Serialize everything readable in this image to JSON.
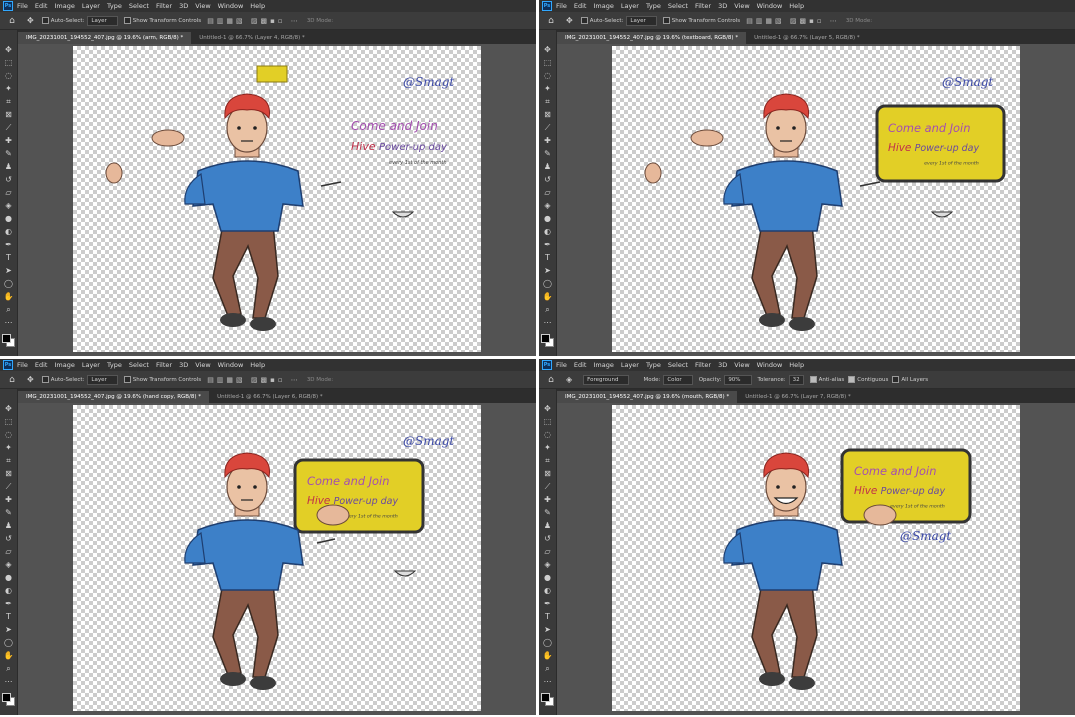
{
  "menu": [
    "File",
    "Edit",
    "Image",
    "Layer",
    "Type",
    "Select",
    "Filter",
    "3D",
    "View",
    "Window",
    "Help"
  ],
  "app_badge": "Ps",
  "colors": {
    "panel": "#535353",
    "menubar": "#323232",
    "shirt": "#3d80c8",
    "pants": "#8a5a48",
    "hair": "#d9463c",
    "board": "#e2cf26"
  },
  "move_options": {
    "auto_select": "Auto-Select:",
    "layer_dd": "Layer",
    "transform": "Show Transform Controls",
    "mode_3d": "3D Mode:"
  },
  "bucket_options": {
    "fill_dd": "Foreground",
    "mode_label": "Mode:",
    "mode_value": "Color",
    "opacity_label": "Opacity:",
    "opacity_value": "90%",
    "tolerance_label": "Tolerance:",
    "tolerance_value": "32",
    "anti_alias": "Anti-alias",
    "contiguous": "Contiguous",
    "all_layers": "All Layers"
  },
  "panes": [
    {
      "tab_active": "IMG_20231001_194552_407.jpg @ 19.6% (arm, RGB/8) *",
      "tab_other": "Untitled-1 @ 66.7% (Layer 4, RGB/8) *"
    },
    {
      "tab_active": "IMG_20231001_194552_407.jpg @ 19.6% (textboard, RGB/8) *",
      "tab_other": "Untitled-1 @ 66.7% (Layer 5, RGB/8) *"
    },
    {
      "tab_active": "IMG_20231001_194552_407.jpg @ 19.6% (hand copy, RGB/8) *",
      "tab_other": "Untitled-1 @ 66.7% (Layer 6, RGB/8) *"
    },
    {
      "tab_active": "IMG_20231001_194552_407.jpg @ 19.6% (mouth, RGB/8) *",
      "tab_other": "Untitled-1 @ 66.7% (Layer 7, RGB/8) *"
    }
  ],
  "drawing": {
    "line1": "Come and Join",
    "line2": "Hive",
    "line3": "Power-up day",
    "line4": "every 1st of the month",
    "signature": "@Smagt"
  }
}
